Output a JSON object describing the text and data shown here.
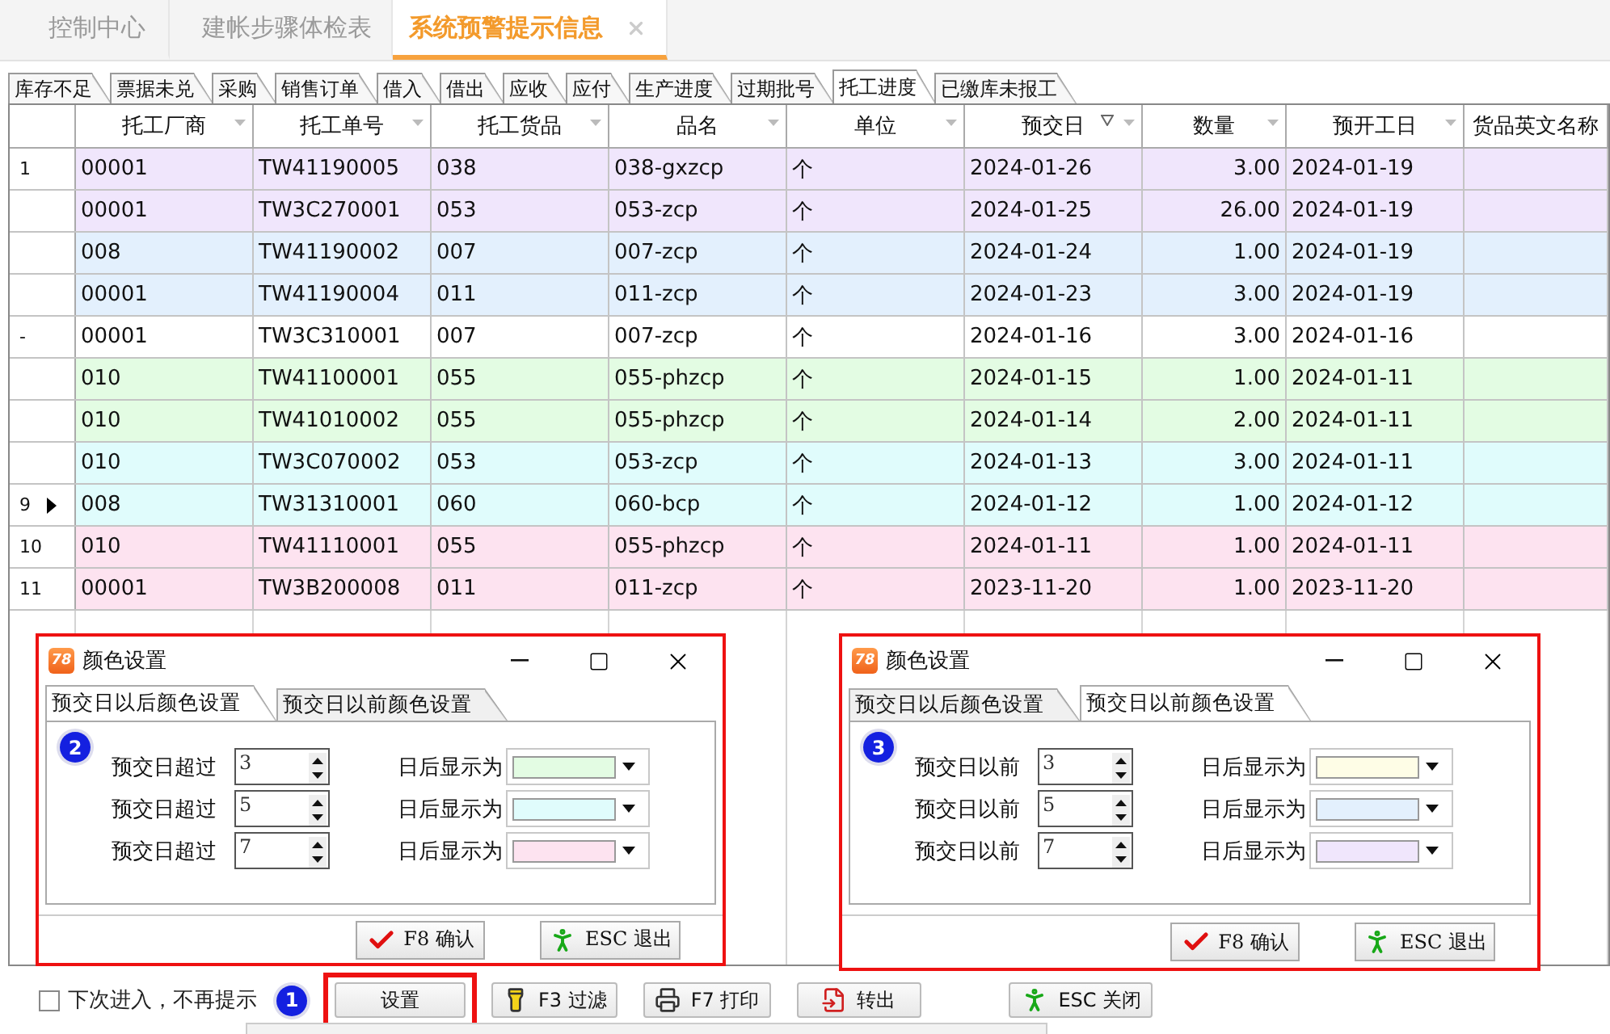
{
  "main_tabs": [
    {
      "label": "控制中心",
      "selected": false,
      "closable": false
    },
    {
      "label": "建帐步骤体检表",
      "selected": false,
      "closable": false
    },
    {
      "label": "系统预警提示信息",
      "selected": true,
      "closable": true
    }
  ],
  "sub_tabs": [
    {
      "label": "库存不足",
      "selected": false
    },
    {
      "label": "票据未兑",
      "selected": false
    },
    {
      "label": "采购",
      "selected": false
    },
    {
      "label": "销售订单",
      "selected": false
    },
    {
      "label": "借入",
      "selected": false
    },
    {
      "label": "借出",
      "selected": false
    },
    {
      "label": "应收",
      "selected": false
    },
    {
      "label": "应付",
      "selected": false
    },
    {
      "label": "生产进度",
      "selected": false
    },
    {
      "label": "过期批号",
      "selected": false
    },
    {
      "label": "托工进度",
      "selected": true
    },
    {
      "label": "已缴库未报工",
      "selected": false
    }
  ],
  "table": {
    "columns": [
      {
        "label": "托工厂商",
        "sorted": false,
        "kind": "text",
        "filter": true
      },
      {
        "label": "托工单号",
        "sorted": false,
        "kind": "text",
        "filter": true
      },
      {
        "label": "托工货品",
        "sorted": false,
        "kind": "text",
        "filter": true
      },
      {
        "label": "品名",
        "sorted": false,
        "kind": "text",
        "filter": true
      },
      {
        "label": "单位",
        "sorted": false,
        "kind": "text",
        "filter": true
      },
      {
        "label": "预交日",
        "sorted": true,
        "kind": "text",
        "filter": true
      },
      {
        "label": "数量",
        "sorted": false,
        "kind": "number",
        "filter": true
      },
      {
        "label": "预开工日",
        "sorted": false,
        "kind": "text",
        "filter": true
      },
      {
        "label": "货品英文名称",
        "sorted": false,
        "kind": "text",
        "filter": false
      }
    ],
    "rows": [
      {
        "marker": "1",
        "current": false,
        "color": "#f0e6fc",
        "cells": [
          "00001",
          "TW41190005",
          "038",
          "038-gxzcp",
          "个",
          "2024-01-26",
          "3.00",
          "2024-01-19"
        ]
      },
      {
        "marker": "",
        "current": false,
        "color": "#f0e6fc",
        "cells": [
          "00001",
          "TW3C270001",
          "053",
          "053-zcp",
          "个",
          "2024-01-25",
          "26.00",
          "2024-01-19"
        ]
      },
      {
        "marker": "",
        "current": false,
        "color": "#e3f0fd",
        "cells": [
          "008",
          "TW41190002",
          "007",
          "007-zcp",
          "个",
          "2024-01-24",
          "1.00",
          "2024-01-19"
        ]
      },
      {
        "marker": "",
        "current": false,
        "color": "#e3f0fd",
        "cells": [
          "00001",
          "TW41190004",
          "011",
          "011-zcp",
          "个",
          "2024-01-23",
          "3.00",
          "2024-01-19"
        ]
      },
      {
        "marker": "-",
        "current": false,
        "color": "#ffffff",
        "cells": [
          "00001",
          "TW3C310001",
          "007",
          "007-zcp",
          "个",
          "2024-01-16",
          "3.00",
          "2024-01-16"
        ]
      },
      {
        "marker": "",
        "current": false,
        "color": "#e3fce3",
        "cells": [
          "010",
          "TW41100001",
          "055",
          "055-phzcp",
          "个",
          "2024-01-15",
          "1.00",
          "2024-01-11"
        ]
      },
      {
        "marker": "",
        "current": false,
        "color": "#e3fce3",
        "cells": [
          "010",
          "TW41010002",
          "055",
          "055-phzcp",
          "个",
          "2024-01-14",
          "2.00",
          "2024-01-11"
        ]
      },
      {
        "marker": "",
        "current": false,
        "color": "#e0fcfc",
        "cells": [
          "010",
          "TW3C070002",
          "053",
          "053-zcp",
          "个",
          "2024-01-13",
          "3.00",
          "2024-01-11"
        ]
      },
      {
        "marker": "9",
        "current": true,
        "color": "#e0fcfc",
        "cells": [
          "008",
          "TW31310001",
          "060",
          "060-bcp",
          "个",
          "2024-01-12",
          "1.00",
          "2024-01-12"
        ]
      },
      {
        "marker": "10",
        "current": false,
        "color": "#fde3f0",
        "cells": [
          "010",
          "TW41110001",
          "055",
          "055-phzcp",
          "个",
          "2024-01-11",
          "1.00",
          "2024-01-11"
        ]
      },
      {
        "marker": "11",
        "current": false,
        "color": "#fde3f0",
        "cells": [
          "00001",
          "TW3B200008",
          "011",
          "011-zcp",
          "个",
          "2023-11-20",
          "1.00",
          "2023-11-20"
        ]
      }
    ]
  },
  "dialogs": [
    {
      "logo": "78",
      "title": "颜色设置",
      "highlighted": true,
      "badge": "2",
      "tabs": [
        {
          "label": "预交日以后颜色设置",
          "selected": true
        },
        {
          "label": "预交日以前颜色设置",
          "selected": false
        }
      ],
      "rows": [
        {
          "label": "预交日超过",
          "value": "3",
          "color_label": "日后显示为",
          "color": "#e3fce3"
        },
        {
          "label": "预交日超过",
          "value": "5",
          "color_label": "日后显示为",
          "color": "#e0fcfc"
        },
        {
          "label": "预交日超过",
          "value": "7",
          "color_label": "日后显示为",
          "color": "#fde3f0"
        }
      ],
      "buttons": [
        {
          "label": "F8 确认",
          "kind": "confirm"
        },
        {
          "label": "ESC 退出",
          "kind": "exit"
        }
      ]
    },
    {
      "logo": "78",
      "title": "颜色设置",
      "highlighted": true,
      "badge": "3",
      "tabs": [
        {
          "label": "预交日以后颜色设置",
          "selected": false
        },
        {
          "label": "预交日以前颜色设置",
          "selected": true
        }
      ],
      "rows": [
        {
          "label": "预交日以前",
          "value": "3",
          "color_label": "日后显示为",
          "color": "#fefde6"
        },
        {
          "label": "预交日以前",
          "value": "5",
          "color_label": "日后显示为",
          "color": "#e3f0fd"
        },
        {
          "label": "预交日以前",
          "value": "7",
          "color_label": "日后显示为",
          "color": "#f0e6fc"
        }
      ],
      "buttons": [
        {
          "label": "F8 确认",
          "kind": "confirm"
        },
        {
          "label": "ESC 退出",
          "kind": "exit"
        }
      ]
    }
  ],
  "bottom_bar": {
    "checkbox": {
      "label": "下次进入，不再提示",
      "checked": false
    },
    "badge": "1",
    "buttons": [
      {
        "label": "设置",
        "kind": "plain",
        "highlighted": true
      },
      {
        "label": "F3 过滤",
        "kind": "filter",
        "highlighted": false
      },
      {
        "label": "F7 打印",
        "kind": "print",
        "highlighted": false
      },
      {
        "label": "转出",
        "kind": "export",
        "highlighted": false
      },
      {
        "label": "ESC 关闭",
        "kind": "exit",
        "highlighted": false
      }
    ]
  }
}
